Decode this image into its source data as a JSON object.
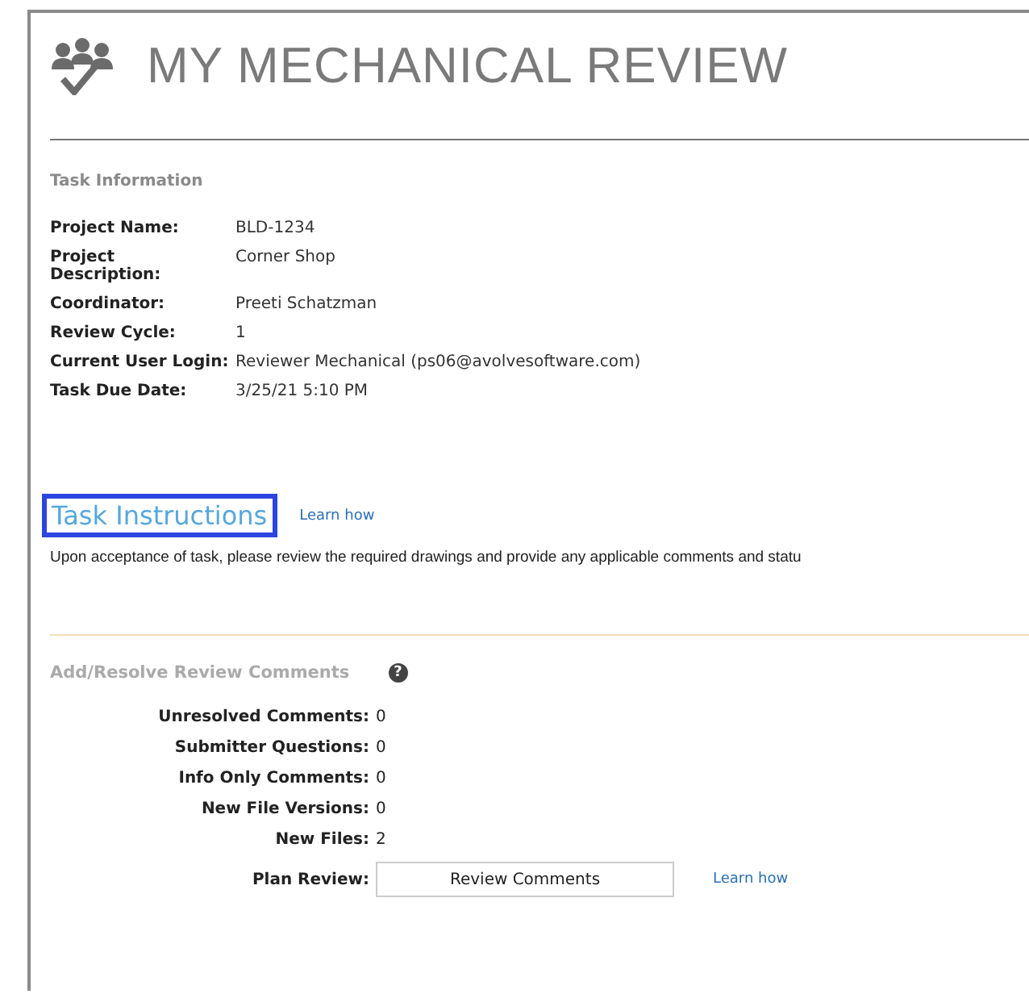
{
  "title": "MY MECHANICAL REVIEW",
  "task_information": {
    "heading": "Task Information",
    "rows": [
      {
        "label": "Project Name:",
        "value": "BLD-1234"
      },
      {
        "label": "Project Description:",
        "value": "Corner Shop"
      },
      {
        "label": "Coordinator:",
        "value": "Preeti Schatzman"
      },
      {
        "label": "Review Cycle:",
        "value": "1"
      },
      {
        "label": "Current User Login:",
        "value": "Reviewer Mechanical (ps06@avolvesoftware.com)"
      },
      {
        "label": "Task Due Date:",
        "value": "3/25/21 5:10 PM"
      }
    ]
  },
  "task_instructions": {
    "heading": "Task Instructions",
    "highlighted": true,
    "link": "Learn how",
    "text": "Upon acceptance of task, please review the required drawings and provide any applicable comments and statu"
  },
  "review_comments": {
    "heading": "Add/Resolve Review Comments",
    "help": "?",
    "rows": [
      {
        "label": "Unresolved Comments:",
        "value": "0"
      },
      {
        "label": "Submitter Questions:",
        "value": "0"
      },
      {
        "label": "Info Only Comments:",
        "value": "0"
      },
      {
        "label": "New File Versions:",
        "value": "0"
      },
      {
        "label": "New Files:",
        "value": "2"
      }
    ],
    "plan_review": {
      "label": "Plan Review:",
      "button": "Review Comments",
      "link": "Learn how"
    }
  }
}
